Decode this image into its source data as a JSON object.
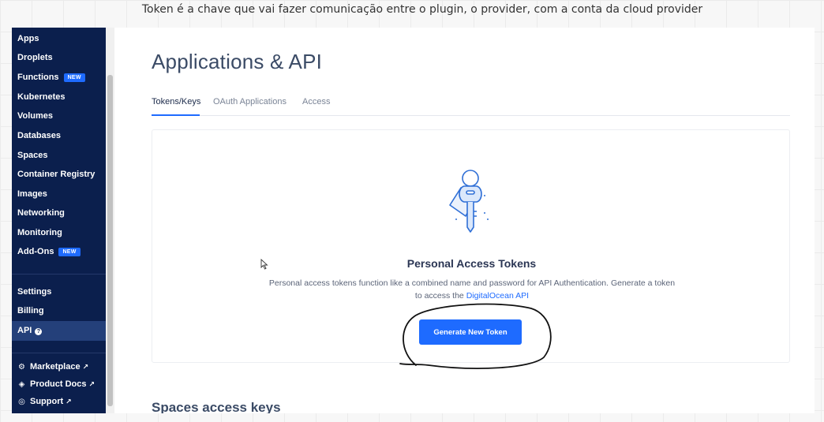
{
  "caption": "Token é a chave que vai fazer comunicação entre o plugin, o provider, com a conta da cloud provider",
  "sidebar": {
    "items": [
      {
        "label": "Apps"
      },
      {
        "label": "Droplets"
      },
      {
        "label": "Functions",
        "badge": "NEW"
      },
      {
        "label": "Kubernetes"
      },
      {
        "label": "Volumes"
      },
      {
        "label": "Databases"
      },
      {
        "label": "Spaces"
      },
      {
        "label": "Container Registry"
      },
      {
        "label": "Images"
      },
      {
        "label": "Networking"
      },
      {
        "label": "Monitoring"
      },
      {
        "label": "Add-Ons",
        "badge": "NEW"
      }
    ],
    "account_items": [
      {
        "label": "Settings"
      },
      {
        "label": "Billing"
      },
      {
        "label": "API",
        "active": true
      }
    ],
    "external_links": [
      {
        "label": "Marketplace",
        "icon": "marketplace-icon"
      },
      {
        "label": "Product Docs",
        "icon": "docs-icon"
      },
      {
        "label": "Support",
        "icon": "support-icon"
      }
    ]
  },
  "page": {
    "title": "Applications & API",
    "tabs": [
      {
        "label": "Tokens/Keys",
        "active": true
      },
      {
        "label": "OAuth Applications",
        "active": false
      },
      {
        "label": "Access",
        "active": false
      }
    ]
  },
  "tokens_card": {
    "title": "Personal Access Tokens",
    "description": "Personal access tokens function like a combined name and password for API Authentication. Generate a token to access the",
    "link_text": "DigitalOcean API",
    "button_label": "Generate New Token",
    "illustration_icon": "key-icon"
  },
  "spaces_section": {
    "title": "Spaces access keys"
  },
  "colors": {
    "sidebar_bg": "#0b1f4d",
    "accent": "#1e6bff",
    "badge": "#1e6bff"
  }
}
